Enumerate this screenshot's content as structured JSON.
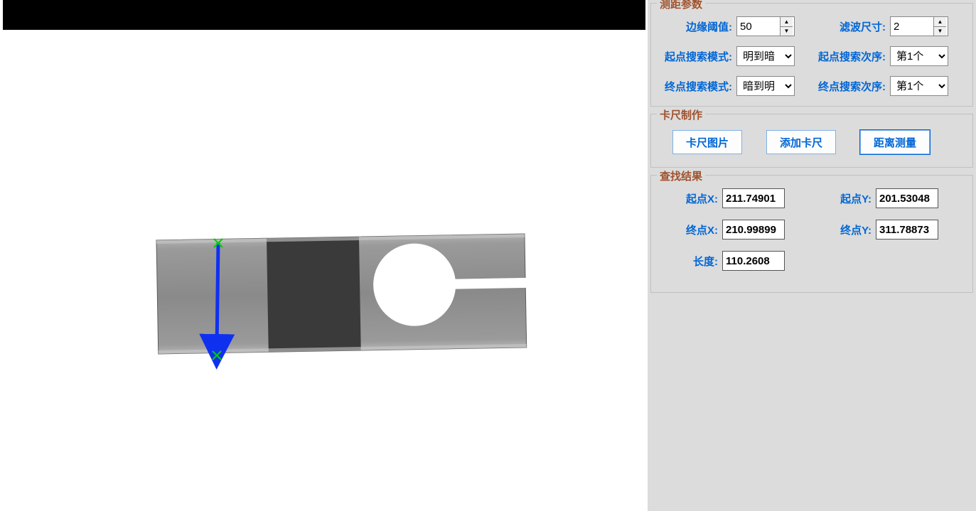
{
  "params": {
    "group_title": "测距参数",
    "edge_threshold_label": "边缘阈值:",
    "edge_threshold_value": "50",
    "filter_size_label": "滤波尺寸:",
    "filter_size_value": "2",
    "start_mode_label": "起点搜索模式:",
    "start_mode_value": "明到暗",
    "start_order_label": "起点搜索次序:",
    "start_order_value": "第1个",
    "end_mode_label": "终点搜索模式:",
    "end_mode_value": "暗到明",
    "end_order_label": "终点搜索次序:",
    "end_order_value": "第1个"
  },
  "caliper": {
    "group_title": "卡尺制作",
    "btn_image": "卡尺图片",
    "btn_add": "添加卡尺",
    "btn_measure": "距离测量"
  },
  "results": {
    "group_title": "查找结果",
    "start_x_label": "起点X:",
    "start_x_value": "211.74901",
    "start_y_label": "起点Y:",
    "start_y_value": "201.53048",
    "end_x_label": "终点X:",
    "end_x_value": "210.99899",
    "end_y_label": "终点Y:",
    "end_y_value": "311.78873",
    "length_label": "长度:",
    "length_value": "110.2608"
  }
}
